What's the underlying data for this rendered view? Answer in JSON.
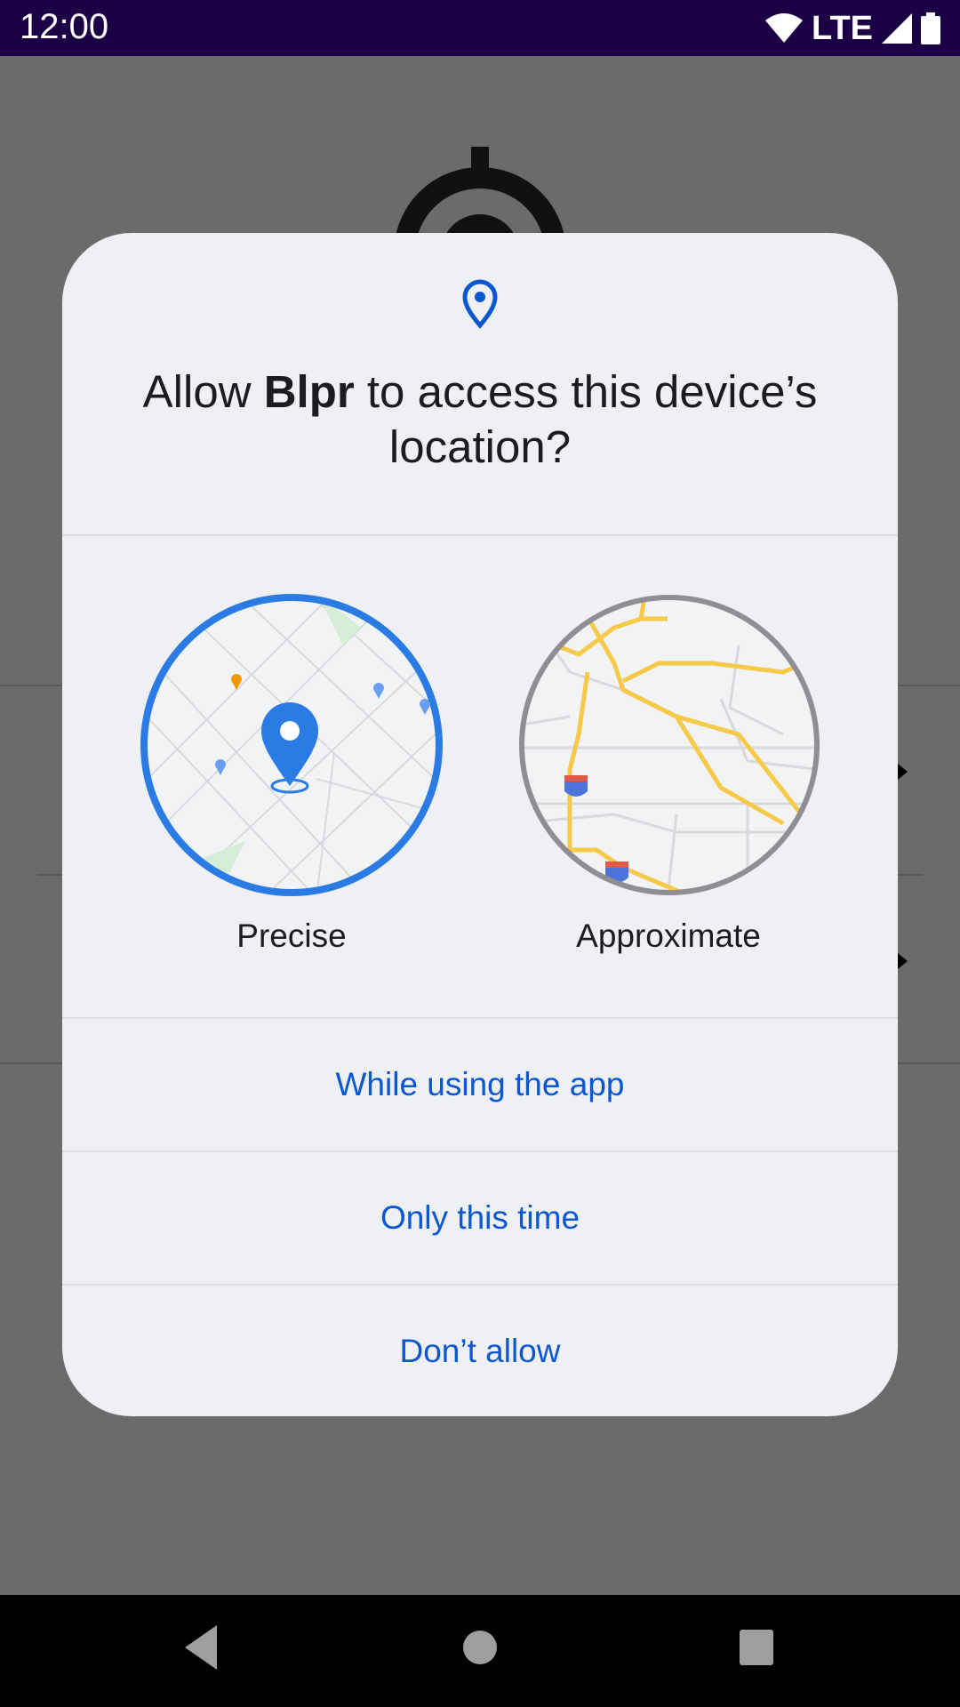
{
  "status_bar": {
    "time": "12:00",
    "network": "LTE",
    "icons": [
      "wifi-icon",
      "cell-signal-icon",
      "battery-icon"
    ]
  },
  "dialog": {
    "title_prefix": "Allow ",
    "app_name": "Blpr",
    "title_suffix": " to access this device’s location?",
    "options": {
      "precise_label": "Precise",
      "approximate_label": "Approximate"
    },
    "actions": {
      "while_using": "While using the app",
      "only_this_time": "Only this time",
      "dont_allow": "Don’t allow"
    }
  },
  "navigation": {
    "icons": [
      "back-icon",
      "home-icon",
      "recents-icon"
    ]
  },
  "colors": {
    "status_bar": "#1b0046",
    "scrim": "#6b6b6b",
    "dialog_bg": "#eff0f4",
    "accent": "#0b57d0",
    "precise_ring": "#2a7be4",
    "approximate_ring": "#8e8e93",
    "road_yellow": "#f7c948"
  }
}
